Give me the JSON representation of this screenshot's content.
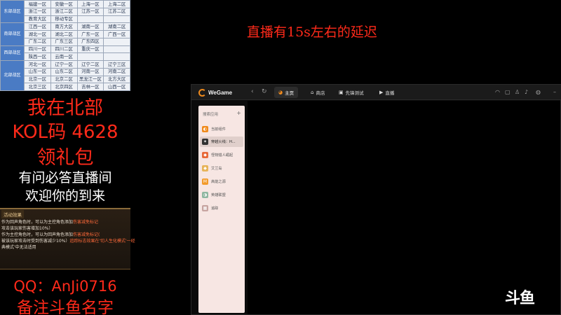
{
  "server_table": {
    "groups": [
      {
        "region": "东部战区",
        "rows": [
          [
            "福建一区",
            "安徽一区",
            "上海一区",
            "上海二区"
          ],
          [
            "浙江一区",
            "浙江二区",
            "江苏一区",
            "江苏二区"
          ],
          [
            "教育大区",
            "移动专区",
            "",
            ""
          ]
        ]
      },
      {
        "region": "南部战区",
        "rows": [
          [
            "江西一区",
            "南方大区",
            "湖南一区",
            "湖南二区"
          ],
          [
            "湖北一区",
            "湖北二区",
            "广东一区",
            "广西一区"
          ],
          [
            "广东二区",
            "广东三区",
            "广东四区",
            ""
          ]
        ]
      },
      {
        "region": "西部战区",
        "rows": [
          [
            "四川一区",
            "四川二区",
            "重庆一区",
            ""
          ],
          [
            "陕西一区",
            "云南一区",
            "",
            ""
          ]
        ]
      },
      {
        "region": "北部战区",
        "rows": [
          [
            "河北一区",
            "辽宁一区",
            "辽宁二区",
            "辽宁三区"
          ],
          [
            "山东一区",
            "山东二区",
            "河南一区",
            "河南二区"
          ],
          [
            "北京一区",
            "北京二区",
            "黑龙江一区",
            "北方大区"
          ],
          [
            "北京三区",
            "北京四区",
            "吉林一区",
            "山西一区"
          ]
        ]
      }
    ]
  },
  "overlay": {
    "line1": "我在北部",
    "line2": "KOL码 4628",
    "line3": "领礼包",
    "line4": "有问必答直播间",
    "line5": "欢迎你的到来",
    "qq": "QQ：AnJi0716",
    "note": "备注斗鱼名字"
  },
  "activity": {
    "title": "活动效果",
    "lines": [
      {
        "text": "作为回声角色时，可以为主控角色添加",
        "hl": "伤害减免标记"
      },
      {
        "text": "攻击该玩家伤害增加10%）",
        "hl": ""
      },
      {
        "text": "作为主控角色时，可以为回声角色添加",
        "hl": "伤害减免标记("
      },
      {
        "text": "被该玩家攻击时受到伤害减少10%）",
        "hl": "追踪标志效果在'切人生化模式'一经"
      },
      {
        "text": "典模式'中无法适用",
        "hl": ""
      }
    ]
  },
  "delay_notice": "直播有15s左右的延迟",
  "wegame": {
    "logo_text": "WeGame",
    "tabs": [
      {
        "icon": "home-icon",
        "glyph": "◕",
        "label": "主页",
        "active": true
      },
      {
        "icon": "store-icon",
        "glyph": "⌂",
        "label": "商店",
        "active": false
      },
      {
        "icon": "test-icon",
        "glyph": "▣",
        "label": "先锋测试",
        "active": false
      },
      {
        "icon": "live-icon",
        "glyph": "▶",
        "label": "直播",
        "active": false
      }
    ],
    "sidebar": {
      "search_label": "搜索应用",
      "items": [
        {
          "label": "当前组件",
          "color": "#f08a1c",
          "glyph": "◐",
          "active": false
        },
        {
          "label": "穿越火线：H...",
          "color": "#333333",
          "glyph": "✦",
          "active": true
        },
        {
          "label": "怪物猎人崛起",
          "color": "#e86a3a",
          "glyph": "◆",
          "active": false
        },
        {
          "label": "艾兰岛",
          "color": "#e7b45a",
          "glyph": "◆",
          "active": false
        },
        {
          "label": "高能之源",
          "color": "#f29a2a",
          "glyph": "M",
          "active": false
        },
        {
          "label": "英雄联盟",
          "color": "#8fb6a0",
          "glyph": "◑",
          "active": false
        },
        {
          "label": "追踪",
          "color": "#c7a4a0",
          "glyph": "▦",
          "active": false
        }
      ]
    }
  },
  "watermark": "斗鱼",
  "colors": {
    "accent_red": "#ff2a1a",
    "wegame_orange": "#f08a1c",
    "sidebar_bg": "#f7e6e3"
  }
}
